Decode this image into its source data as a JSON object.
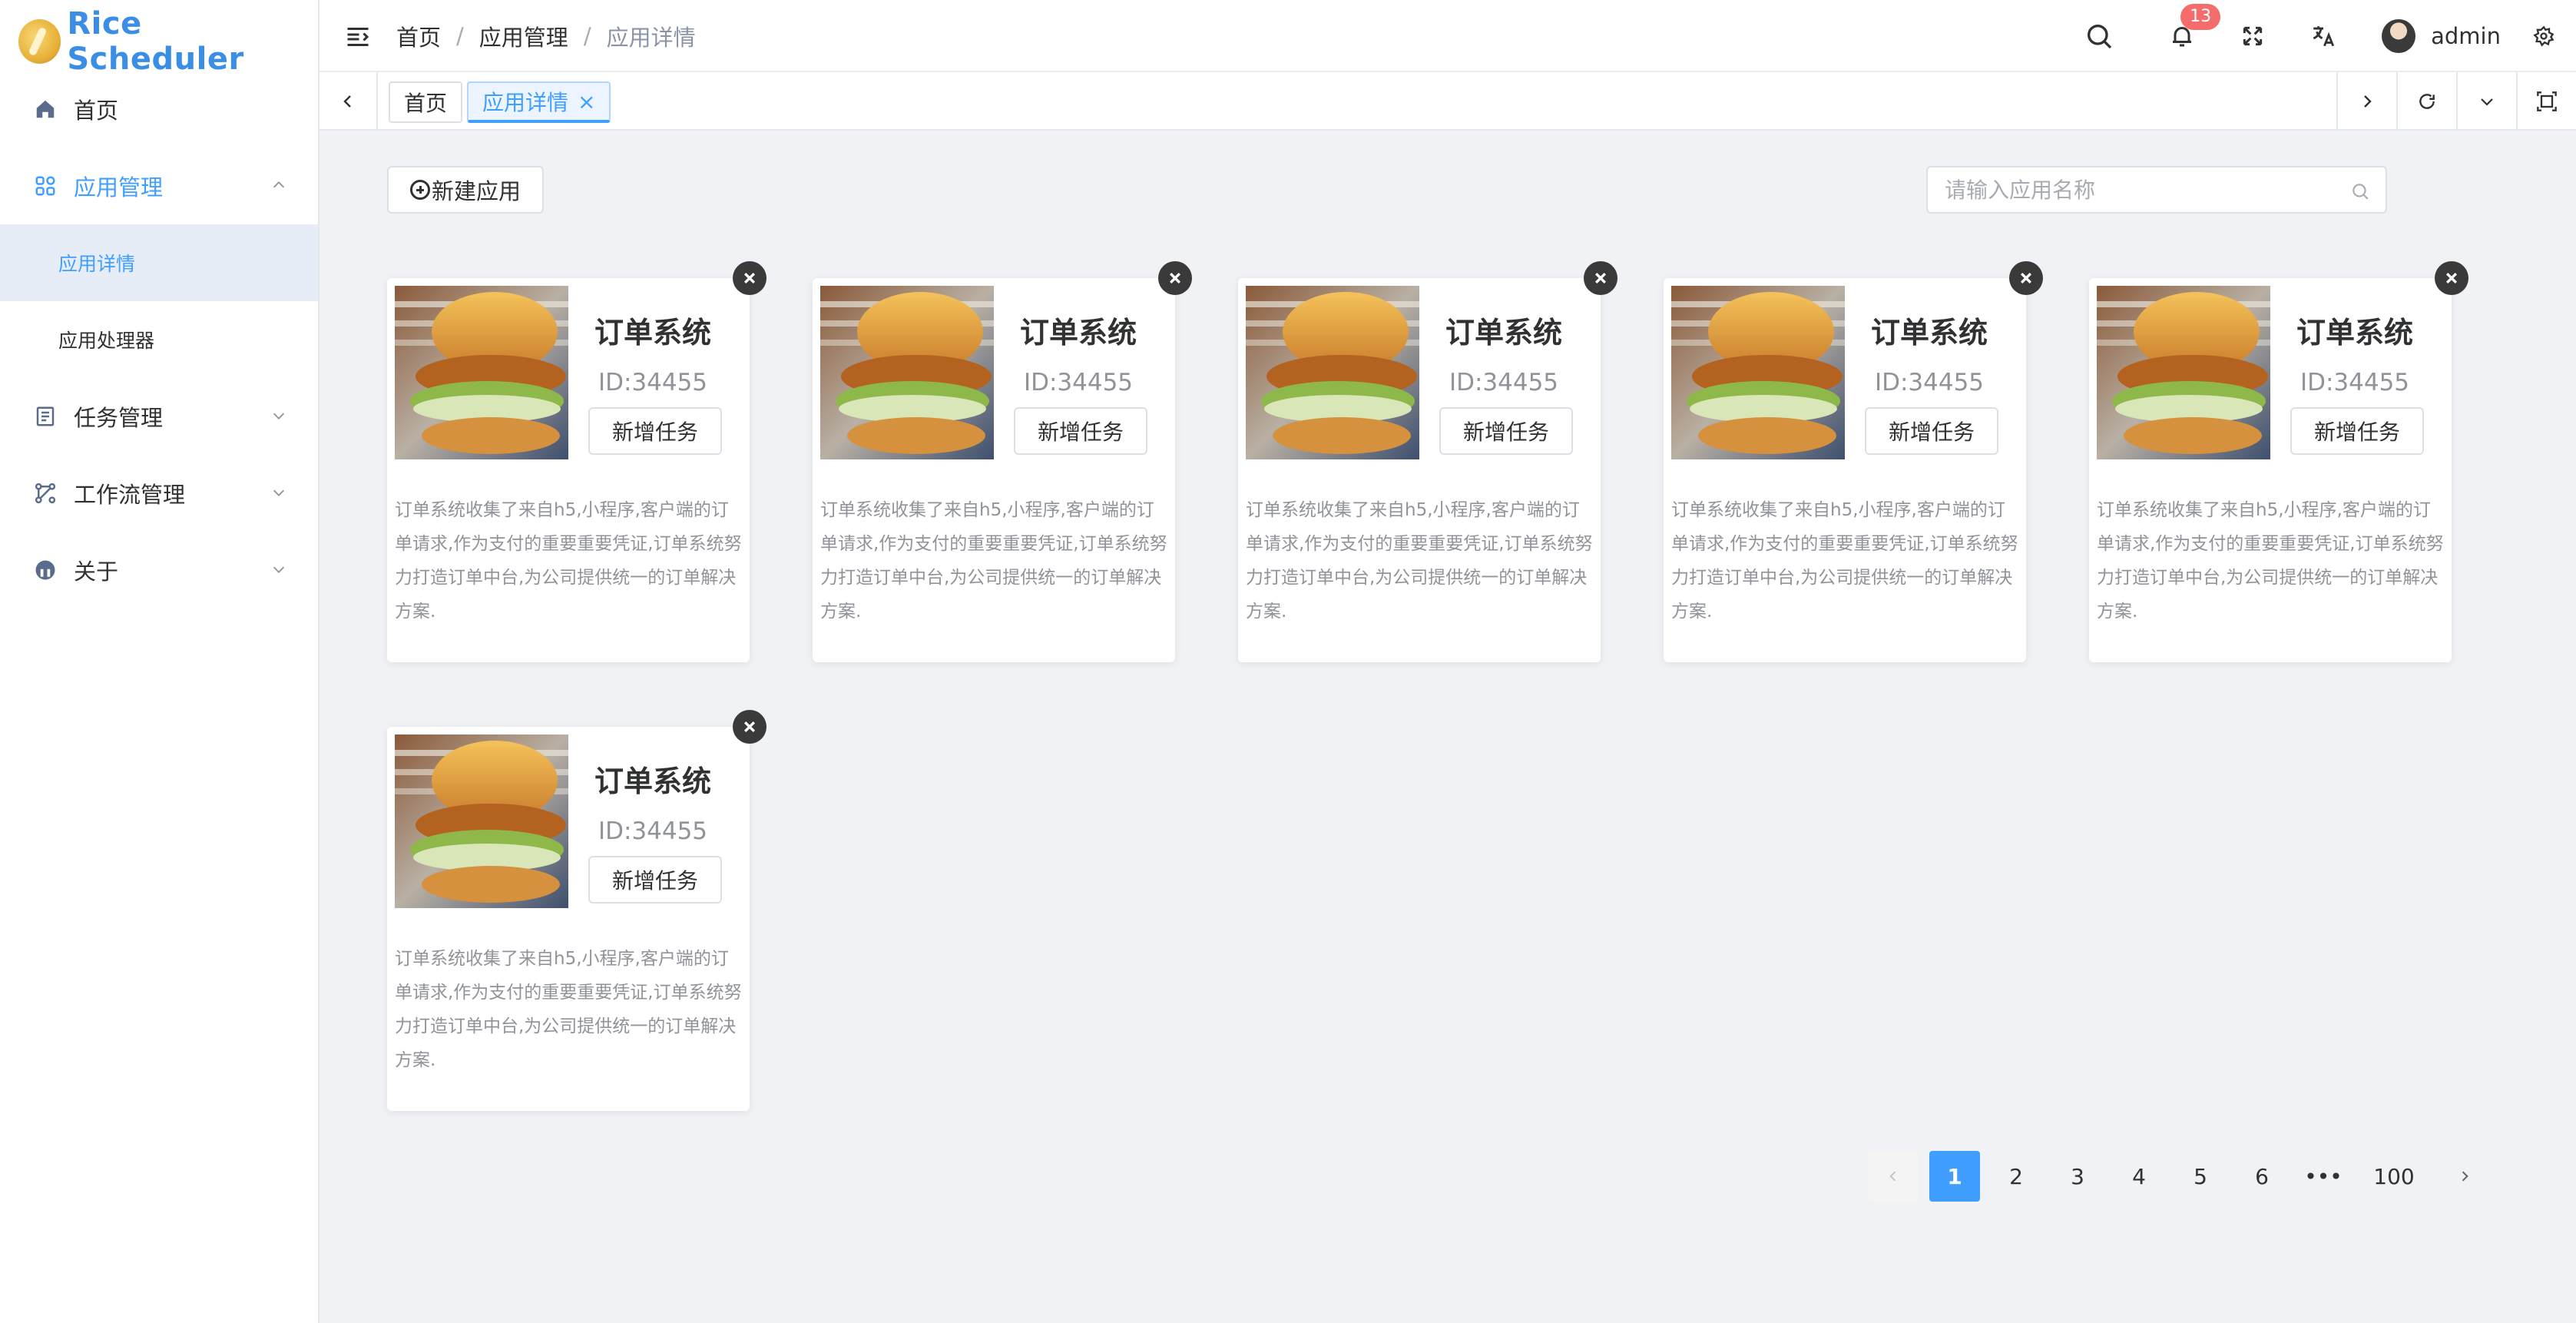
{
  "app": {
    "logo_text": "Rice Scheduler",
    "accent": "#409eff"
  },
  "sidebar": {
    "items": [
      {
        "label": "首页",
        "icon": "home-icon"
      },
      {
        "label": "应用管理",
        "icon": "apps-grid-icon",
        "expanded": true,
        "children": [
          {
            "label": "应用详情",
            "active": true
          },
          {
            "label": "应用处理器",
            "active": false
          }
        ]
      },
      {
        "label": "任务管理",
        "icon": "task-list-icon",
        "expanded": false
      },
      {
        "label": "工作流管理",
        "icon": "workflow-icon",
        "expanded": false
      },
      {
        "label": "关于",
        "icon": "about-icon",
        "expanded": false
      }
    ]
  },
  "header": {
    "breadcrumb": [
      "首页",
      "应用管理",
      "应用详情"
    ],
    "notification_count": "13",
    "username": "admin"
  },
  "tags": [
    {
      "label": "首页",
      "active": false
    },
    {
      "label": "应用详情",
      "active": true,
      "close": "×"
    }
  ],
  "toolbar": {
    "new_app_label": "新建应用",
    "search_placeholder": "请输入应用名称"
  },
  "cards": [
    {
      "title": "订单系统",
      "id": "ID:34455",
      "button": "新增任务",
      "desc": "订单系统收集了来自h5,小程序,客户端的订单请求,作为支付的重要重要凭证,订单系统努力打造订单中台,为公司提供统一的订单解决方案."
    },
    {
      "title": "订单系统",
      "id": "ID:34455",
      "button": "新增任务",
      "desc": "订单系统收集了来自h5,小程序,客户端的订单请求,作为支付的重要重要凭证,订单系统努力打造订单中台,为公司提供统一的订单解决方案."
    },
    {
      "title": "订单系统",
      "id": "ID:34455",
      "button": "新增任务",
      "desc": "订单系统收集了来自h5,小程序,客户端的订单请求,作为支付的重要重要凭证,订单系统努力打造订单中台,为公司提供统一的订单解决方案."
    },
    {
      "title": "订单系统",
      "id": "ID:34455",
      "button": "新增任务",
      "desc": "订单系统收集了来自h5,小程序,客户端的订单请求,作为支付的重要重要凭证,订单系统努力打造订单中台,为公司提供统一的订单解决方案."
    },
    {
      "title": "订单系统",
      "id": "ID:34455",
      "button": "新增任务",
      "desc": "订单系统收集了来自h5,小程序,客户端的订单请求,作为支付的重要重要凭证,订单系统努力打造订单中台,为公司提供统一的订单解决方案."
    },
    {
      "title": "订单系统",
      "id": "ID:34455",
      "button": "新增任务",
      "desc": "订单系统收集了来自h5,小程序,客户端的订单请求,作为支付的重要重要凭证,订单系统努力打造订单中台,为公司提供统一的订单解决方案."
    }
  ],
  "pagination": {
    "pages": [
      "1",
      "2",
      "3",
      "4",
      "5",
      "6",
      "•••",
      "100"
    ],
    "current": "1"
  }
}
